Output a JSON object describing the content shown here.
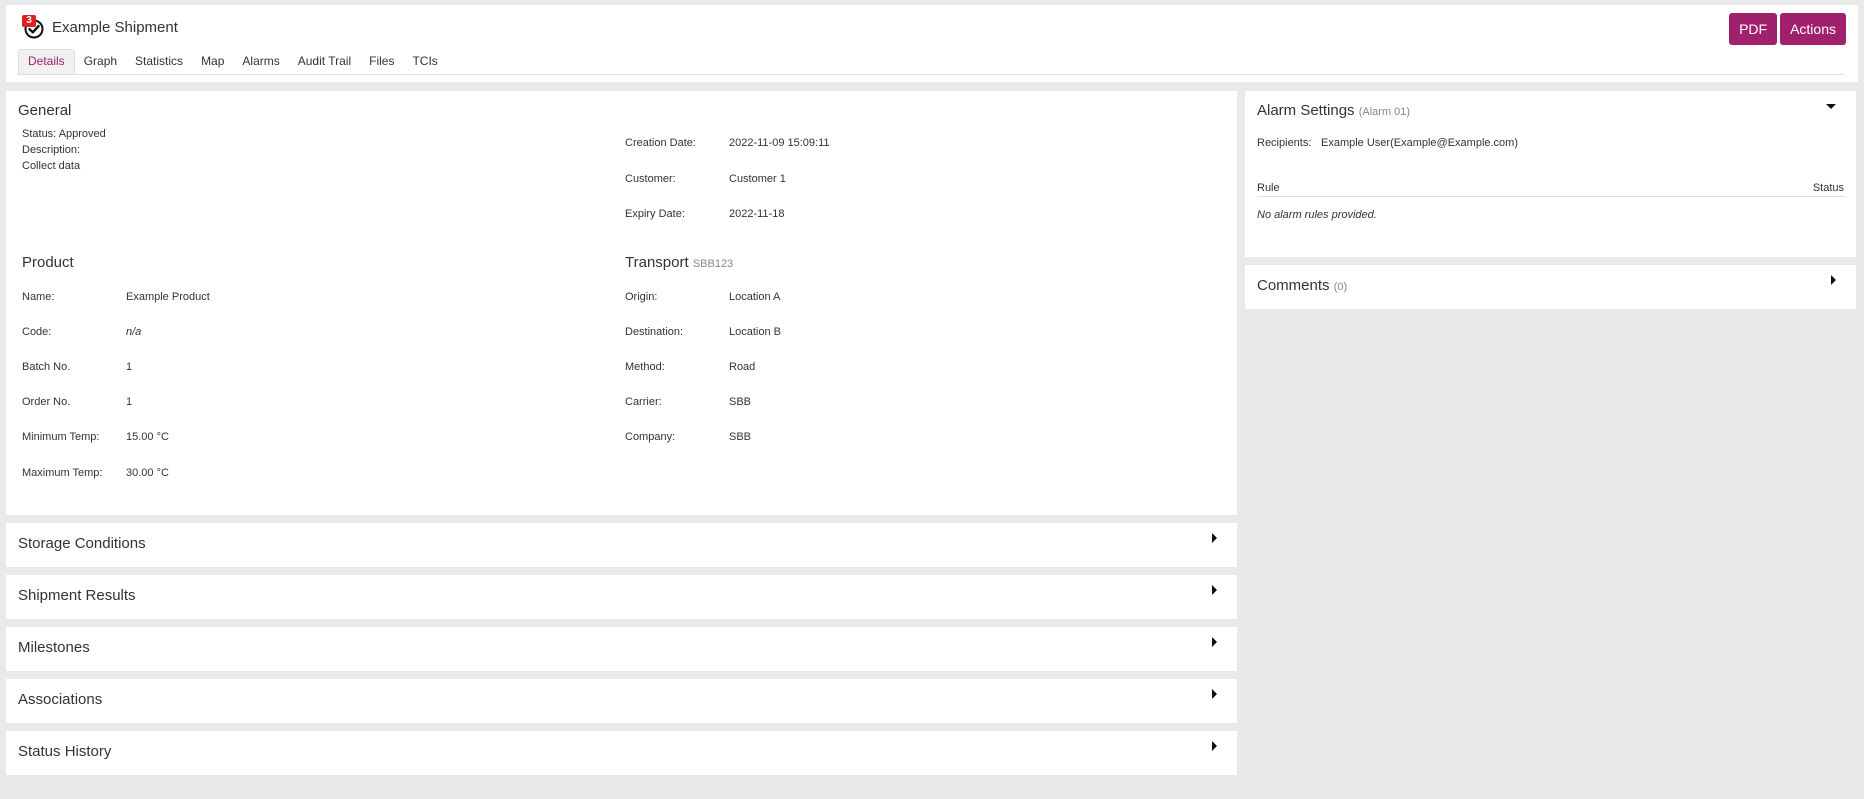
{
  "header": {
    "badge_count": "3",
    "title": "Example Shipment",
    "pdf_label": "PDF",
    "actions_label": "Actions",
    "brand_color": "#a0206e"
  },
  "tabs": [
    {
      "label": "Details",
      "active": true
    },
    {
      "label": "Graph"
    },
    {
      "label": "Statistics"
    },
    {
      "label": "Map"
    },
    {
      "label": "Alarms"
    },
    {
      "label": "Audit Trail"
    },
    {
      "label": "Files"
    },
    {
      "label": "TCIs"
    }
  ],
  "general": {
    "title": "General",
    "status_line": "Status: Approved",
    "description_label": "Description:",
    "description_value": "Collect data",
    "creation_date_label": "Creation Date:",
    "creation_date_value": "2022-11-09 15:09:11",
    "customer_label": "Customer:",
    "customer_value": "Customer 1",
    "expiry_date_label": "Expiry Date:",
    "expiry_date_value": "2022-11-18"
  },
  "product": {
    "title": "Product",
    "rows": [
      {
        "label": "Name:",
        "value": "Example Product"
      },
      {
        "label": "Code:",
        "value": "n/a"
      },
      {
        "label": "Batch No.",
        "value": "1"
      },
      {
        "label": "Order No.",
        "value": "1"
      },
      {
        "label": "Minimum Temp:",
        "value": "15.00 °C"
      },
      {
        "label": "Maximum Temp:",
        "value": "30.00 °C"
      }
    ]
  },
  "transport": {
    "title": "Transport",
    "subtitle": "SBB123",
    "rows": [
      {
        "label": "Origin:",
        "value": "Location A"
      },
      {
        "label": "Destination:",
        "value": "Location B"
      },
      {
        "label": "Method:",
        "value": "Road"
      },
      {
        "label": "Carrier:",
        "value": "SBB"
      },
      {
        "label": "Company:",
        "value": "SBB"
      }
    ]
  },
  "collapsed_sections": [
    "Storage Conditions",
    "Shipment Results",
    "Milestones",
    "Associations",
    "Status History"
  ],
  "alarm_settings": {
    "title": "Alarm Settings",
    "subtitle": "(Alarm 01)",
    "recipients_label": "Recipients:",
    "recipients_value": "Example User(Example@Example.com)",
    "col_rule": "Rule",
    "col_status": "Status",
    "empty_text": "No alarm rules provided."
  },
  "comments": {
    "title": "Comments",
    "count": "(0)"
  }
}
